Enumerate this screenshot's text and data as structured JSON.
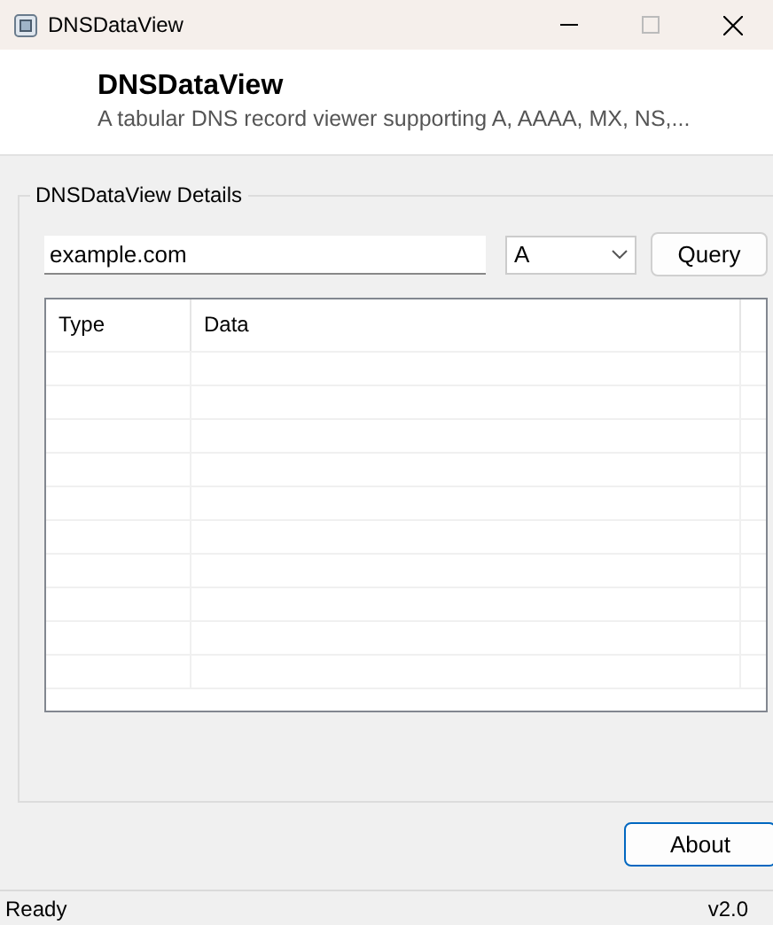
{
  "window": {
    "title": "DNSDataView"
  },
  "header": {
    "title": "DNSDataView",
    "subtitle": "A tabular DNS record viewer supporting A, AAAA, MX, NS,..."
  },
  "group": {
    "title": "DNSDataView Details",
    "domain_field": {
      "value": "example.com"
    },
    "type_dropdown": {
      "value": "A"
    },
    "query_button": "Query",
    "table": {
      "columns": [
        "Type",
        "Data"
      ]
    }
  },
  "about_button": "About",
  "status_bar": {
    "left": "Ready",
    "right": "v2.0"
  }
}
